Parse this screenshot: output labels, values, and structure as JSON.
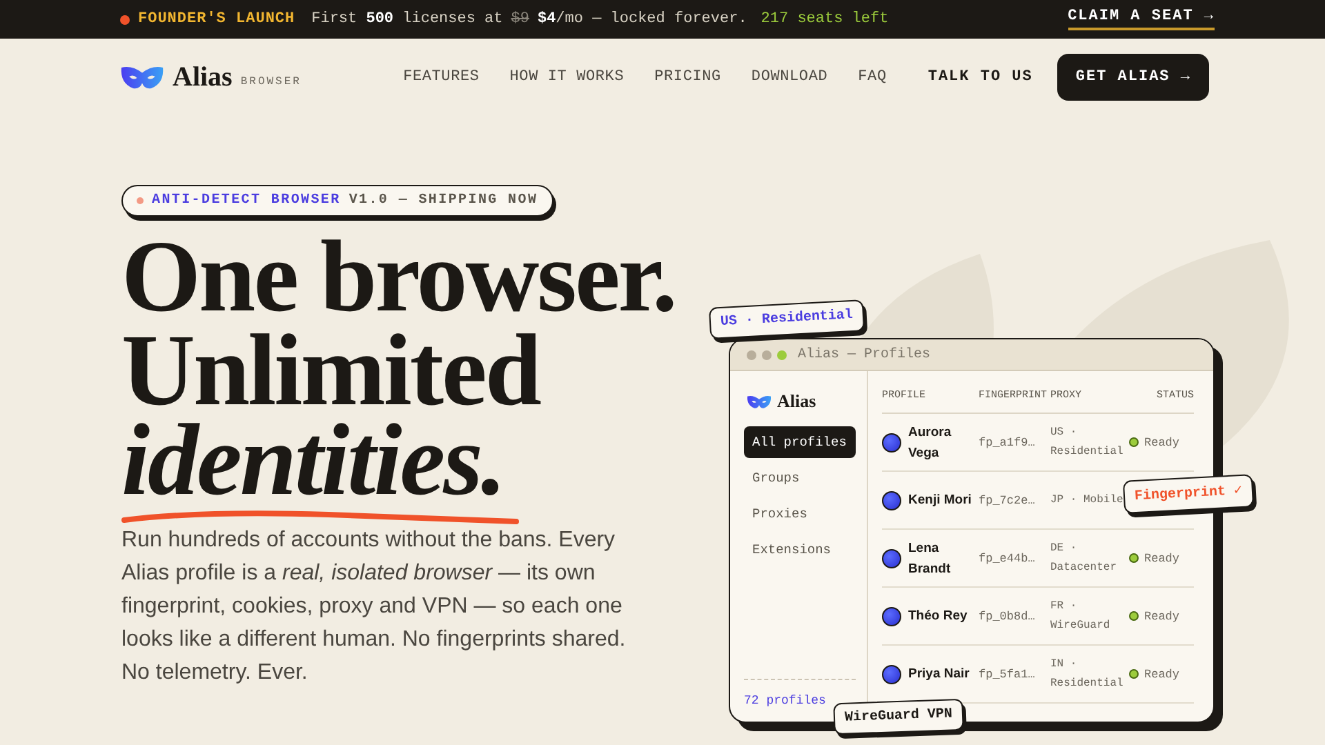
{
  "promo_bar": {
    "badge": "FOUNDER'S LAUNCH",
    "lead": "First **500** licenses at",
    "old_price": "$9",
    "offer": "**$4**/mo — locked forever.",
    "seats": "217 seats left",
    "cta": "CLAIM A SEAT →"
  },
  "nav": {
    "logo": "Alias",
    "logo_tag": "BROWSER",
    "links": [
      "FEATURES",
      "HOW IT WORKS",
      "PRICING",
      "DOWNLOAD",
      "FAQ"
    ],
    "secondary": "TALK TO US",
    "primary": "GET ALIAS →"
  },
  "hero": {
    "pill_highlight": "ANTI-DETECT BROWSER",
    "pill_rest": "V1.0 — SHIPPING NOW",
    "headline": [
      "One browser.",
      "Unlimited"
    ],
    "headline_italic": "identities.",
    "body": "Run hundreds of accounts without the bans. Every Alias profile is a *real, isolated browser* — its own fingerprint, cookies, proxy and VPN — so each one looks like a different human. No fingerprints shared. No telemetry. Ever."
  },
  "app_window": {
    "title": "Alias — Profiles",
    "brand": "Alias",
    "sidebar": [
      {
        "label": "All profiles",
        "selected": true
      },
      {
        "label": "Groups",
        "selected": false
      },
      {
        "label": "Proxies",
        "selected": false
      },
      {
        "label": "Extensions",
        "selected": false
      }
    ],
    "count": "72 profiles",
    "columns": [
      "PROFILE",
      "FINGERPRINT",
      "PROXY",
      "STATUS"
    ],
    "rows": [
      {
        "name": "Aurora Vega",
        "fingerprint": "fp_a1f9…",
        "proxy": "US · Residential",
        "status": "Ready"
      },
      {
        "name": "Kenji Mori",
        "fingerprint": "fp_7c2e…",
        "proxy": "JP · Mobile"
      },
      {
        "name": "Lena Brandt",
        "fingerprint": "fp_e44b…",
        "proxy": "DE · Datacenter",
        "status": "Ready"
      },
      {
        "name": "Théo Rey",
        "fingerprint": "fp_0b8d…",
        "proxy": "FR · WireGuard",
        "status": "Ready"
      },
      {
        "name": "Priya Nair",
        "fingerprint": "fp_5fa1…",
        "proxy": "IN · Residential",
        "status": "Ready"
      }
    ]
  },
  "floating_tags": [
    {
      "kind": "proxy",
      "label": "US · Residential"
    },
    {
      "kind": "check",
      "label": "Fingerprint ✓"
    },
    {
      "kind": "vpn",
      "label": "WireGuard VPN"
    }
  ]
}
